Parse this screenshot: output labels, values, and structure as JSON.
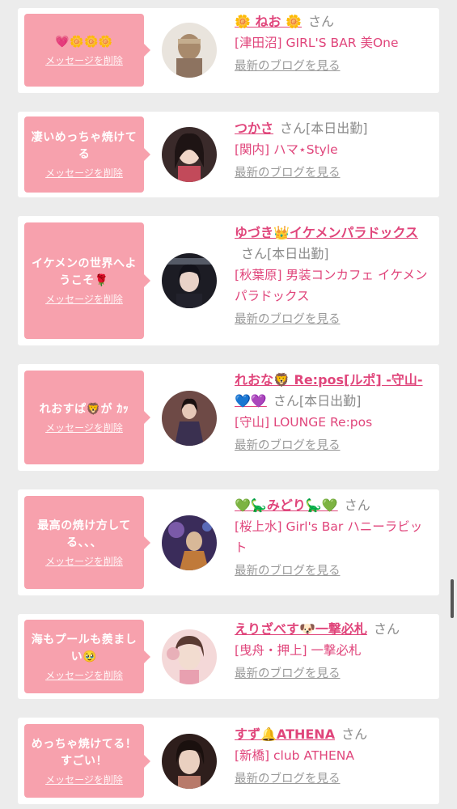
{
  "delete_label": "メッセージを削除",
  "blog_label": "最新のブログを見る",
  "honorific": "さん",
  "colors": {
    "bubble": "#f7a1ad",
    "name": "#e0457b",
    "background": "#ececec"
  },
  "entries": [
    {
      "message": "💗🌼🌼🌼",
      "name": "🌼 ねお 🌼",
      "status": "",
      "shop": "[津田沼] GIRL'S BAR 美One",
      "avatar_icon": "avatar-photo"
    },
    {
      "message": "凄いめっちゃ焼けてる",
      "name": "つかさ",
      "status": "[本日出勤]",
      "shop": "[関内] ハマ⋆Style",
      "avatar_icon": "avatar-photo"
    },
    {
      "message": "イケメンの世界へようこそ🌹",
      "name": "ゆづき👑イケメンパラドックス",
      "status": "[本日出勤]",
      "shop": "[秋葉原] 男装コンカフェ イケメンパラドックス",
      "avatar_icon": "avatar-photo"
    },
    {
      "message": "れおすぱ🦁が ｶｯ",
      "name": "れおな🦁 Re:pos[ルポ] -守山-💙💜",
      "status": "[本日出勤]",
      "shop": "[守山] LOUNGE Re:pos",
      "avatar_icon": "avatar-photo"
    },
    {
      "message": "最高の焼け方してる、、、",
      "name": "💚🦕みどり🦕💚",
      "status": "",
      "shop": "[桜上水] Girl's Bar ハニーラビット",
      "avatar_icon": "avatar-photo"
    },
    {
      "message": "海もプールも羨ましい🥹",
      "name": "えりざべす🐶一撃必札",
      "status": "",
      "shop": "[曳舟・押上] 一撃必札",
      "avatar_icon": "avatar-photo"
    },
    {
      "message": "めっちゃ焼けてる！すごい！",
      "name": "すず🔔ATHENA",
      "status": "",
      "shop": "[新橋] club ATHENA",
      "avatar_icon": "avatar-photo"
    }
  ]
}
